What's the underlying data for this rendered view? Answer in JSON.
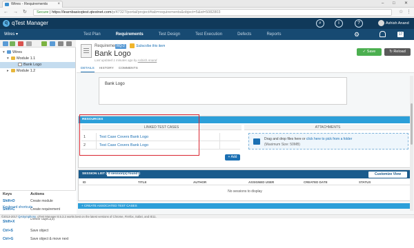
{
  "browser": {
    "tab_title": "Wires - Requirements",
    "url_secure": "Secure",
    "url_host": "https://learnbasicqtest.qtestnet.com",
    "url_path": "/p/47327/portal/project#tab=requirements&object=5&id=5082803",
    "window_controls": [
      "–",
      "□",
      "✕"
    ]
  },
  "appbar": {
    "logo_letter": "q",
    "logo_text": "qTest Manager",
    "user_name": "Ashish Anand"
  },
  "navbar": {
    "project": "Wires ▾",
    "tabs": [
      "Test Plan",
      "Requirements",
      "Test Design",
      "Test Execution",
      "Defects",
      "Reports"
    ],
    "notification_count": "17"
  },
  "tree": {
    "items": [
      {
        "label": "Wires",
        "arrow": "▾"
      },
      {
        "label": "Module 1.1",
        "arrow": "▾"
      },
      {
        "label": "Bank Logo",
        "arrow": ""
      },
      {
        "label": "Module 1.2",
        "arrow": "▸"
      }
    ]
  },
  "shortcuts": {
    "keys_header": "Keys",
    "actions_header": "Actions",
    "rows": [
      {
        "key": "Shift+D",
        "action": "Create module"
      },
      {
        "key": "Shift+C",
        "action": "Create requirement"
      },
      {
        "key": "Shift+Delete, Shift+X",
        "action": "Delete object(s)"
      },
      {
        "key": "Ctrl+S",
        "action": "Save object"
      },
      {
        "key": "Ctrl+G",
        "action": "Save object & move next"
      }
    ],
    "link": "Keyboard shortcuts"
  },
  "requirement": {
    "type_label": "Requirement",
    "id": "RQ-2",
    "subscribe": "Subscribe this item",
    "title": "Bank Logo",
    "updated_prefix": "Last updated 1 minutes ago by",
    "updated_by": "Ashish Anand",
    "save": "✓ Save",
    "reload": "↻ Reload",
    "subtabs": [
      "DETAILS",
      "HISTORY",
      "COMMENTS"
    ],
    "description": "Bank Logo"
  },
  "resources": {
    "header": "RESOURCES",
    "linked_header": "LINKED TEST CASES",
    "attachments_header": "ATTACHMENTS",
    "rows": [
      {
        "num": "1",
        "title": "Test Case Covers Bank Logo"
      },
      {
        "num": "2",
        "title": "Test Case Covers Bank Logo"
      }
    ],
    "add": "+ Add",
    "drop_text": "Drag and drop files here or",
    "drop_link": "click here to pick from a folder",
    "drop_max": "(Maximum Size: 50MB)"
  },
  "sessions": {
    "header": "SESSION LIST (",
    "count": "0 session(s) found",
    "header_end": ")",
    "customize": "Customize View",
    "columns": [
      "ID",
      "TITLE",
      "AUTHOR",
      "ASSIGNED USER",
      "CREATED DATE",
      "STATUS"
    ],
    "empty": "No sessions to display"
  },
  "create_assoc": "+ CREATE ASSOCIATED TEST CASES",
  "footer": {
    "copyright": "©2013-2017",
    "company": "QASymphony",
    "text": ". qTest Manager 8.5.3.2 works best on the latest versions of Chrome, Firefox, Safari, and IE11."
  },
  "colors": {
    "appbar": "#10395a",
    "navbar": "#174a72",
    "accent": "#2c9fd9",
    "save": "#4caf50",
    "highlight": "#d9232e"
  }
}
